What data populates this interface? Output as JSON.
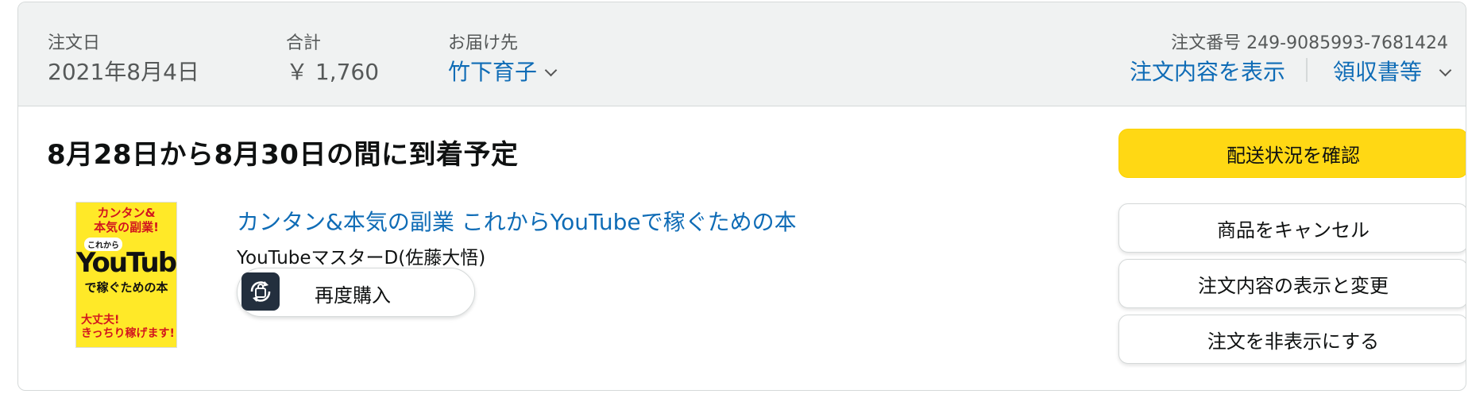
{
  "header": {
    "order_date_label": "注文日",
    "order_date": "2021年8月4日",
    "total_label": "合計",
    "total": "￥ 1,760",
    "ship_to_label": "お届け先",
    "ship_to": "竹下育子",
    "order_number_label": "注文番号 249-9085993-7681424",
    "view_details": "注文内容を表示",
    "receipt": "領収書等"
  },
  "delivery_status": "8月28日から8月30日の間に到着予定",
  "item": {
    "title": "カンタン&本気の副業 これからYouTubeで稼ぐための本",
    "author": "YouTubeマスターD(佐藤大悟)",
    "buy_again": "再度購入",
    "cover": {
      "line1": "カンタン&",
      "line2": "本気の副業!",
      "line3": "これから",
      "line4": "YouTube",
      "line5": "で稼ぐための本",
      "line6": "大丈夫!",
      "line7": "きっちり稼げます!"
    }
  },
  "actions": {
    "track": "配送状況を確認",
    "cancel": "商品をキャンセル",
    "view_edit": "注文内容の表示と変更",
    "hide": "注文を非表示にする"
  },
  "colors": {
    "link": "#0f6cb6",
    "primary_button": "#ffd814",
    "header_bg": "#f0f2f2"
  }
}
